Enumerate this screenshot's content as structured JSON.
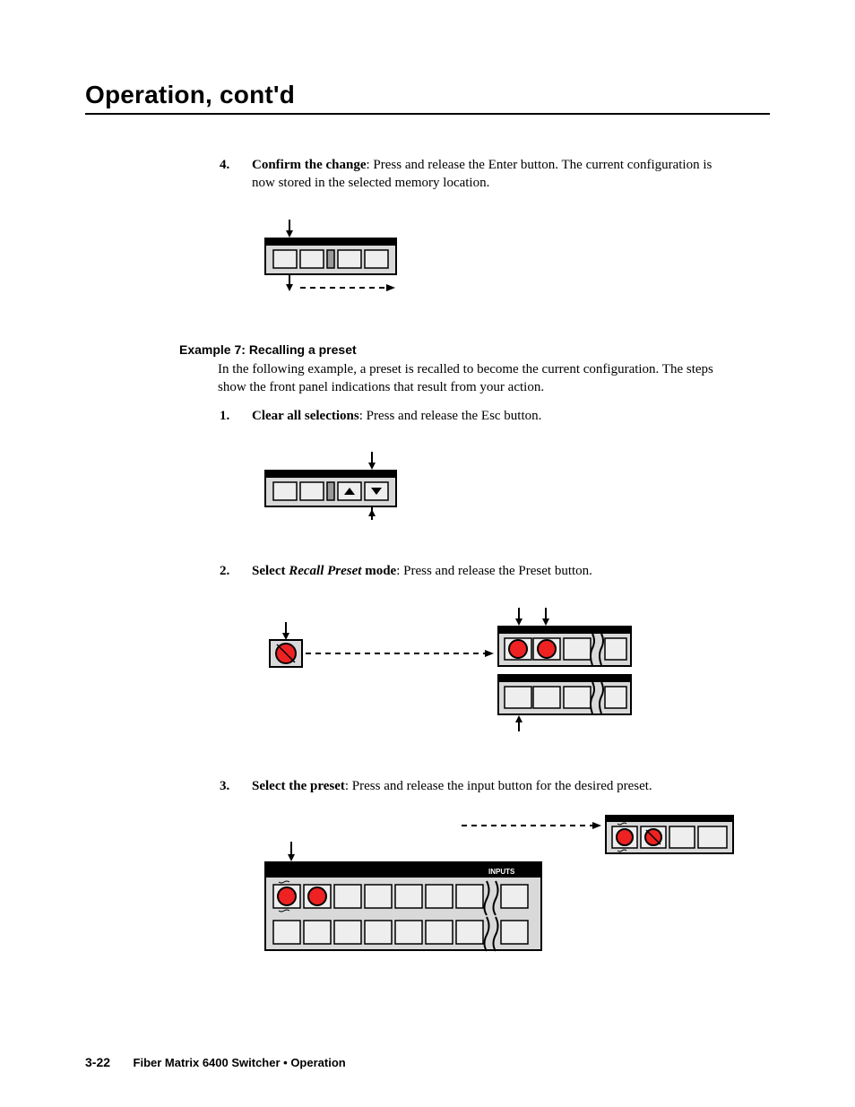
{
  "header": "Operation, cont'd",
  "step4": {
    "num": "4.",
    "bold": "Confirm the change",
    "rest": ": Press and release the Enter button.  The current configuration is now stored in the selected memory location."
  },
  "exampleHeading": "Example 7: Recalling a preset",
  "lead": "In the following example, a preset is recalled to become the current configuration.  The steps show the front panel indications that result from your action.",
  "step1": {
    "num": "1.",
    "bold": "Clear all selections",
    "rest": ": Press and release the Esc button."
  },
  "step2": {
    "num": "2.",
    "pre": "Select ",
    "ital": "Recall Preset",
    "rest": " mode",
    "after": ": Press and release the Preset button."
  },
  "step3": {
    "num": "3.",
    "bold": "Select the preset",
    "rest": ": Press and release the input button for the desired preset."
  },
  "inputsLabel": "INPUTS",
  "footer": {
    "page": "3-22",
    "title": "Fiber Matrix 6400 Switcher • Operation"
  }
}
